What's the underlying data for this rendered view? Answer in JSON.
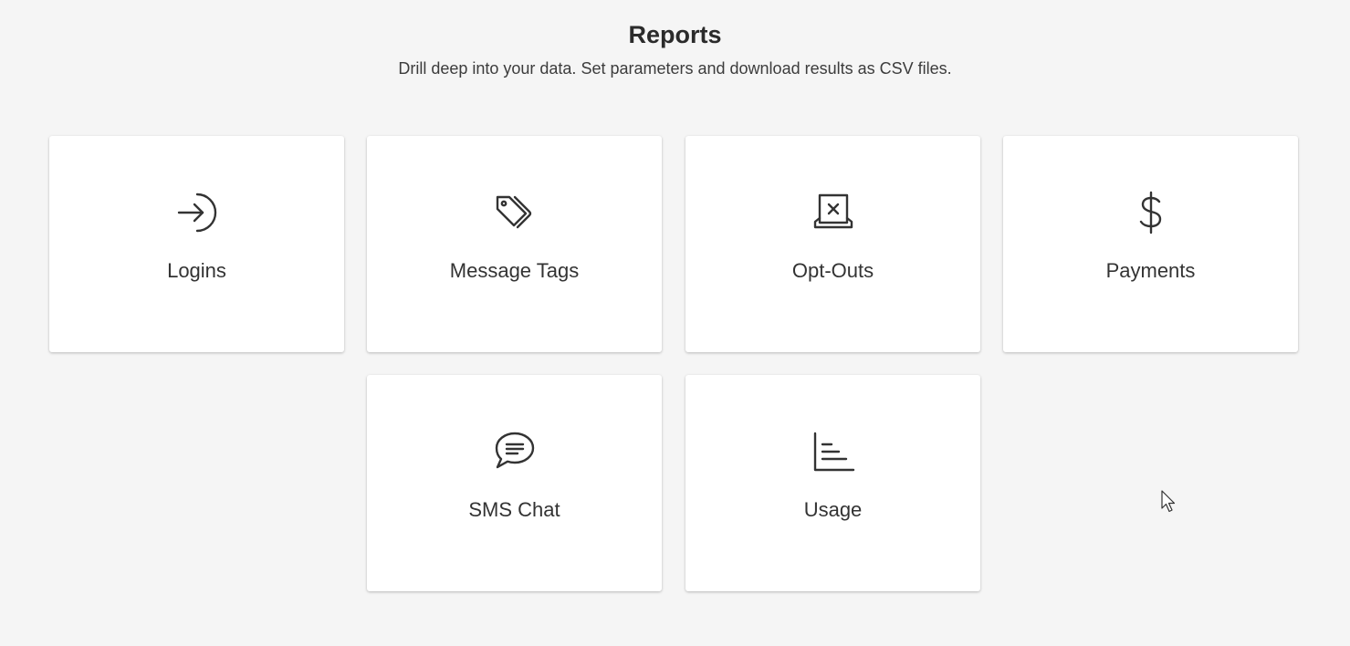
{
  "header": {
    "title": "Reports",
    "subtitle": "Drill deep into your data. Set parameters and download results as CSV files."
  },
  "reports": [
    {
      "label": "Logins",
      "icon": "login-arrow-icon"
    },
    {
      "label": "Message Tags",
      "icon": "tags-icon"
    },
    {
      "label": "Opt-Outs",
      "icon": "opt-out-icon"
    },
    {
      "label": "Payments",
      "icon": "dollar-icon"
    },
    {
      "label": "SMS Chat",
      "icon": "chat-bubble-icon"
    },
    {
      "label": "Usage",
      "icon": "bar-chart-icon"
    }
  ],
  "colors": {
    "background": "#f5f5f5",
    "card": "#ffffff",
    "text": "#333333"
  }
}
